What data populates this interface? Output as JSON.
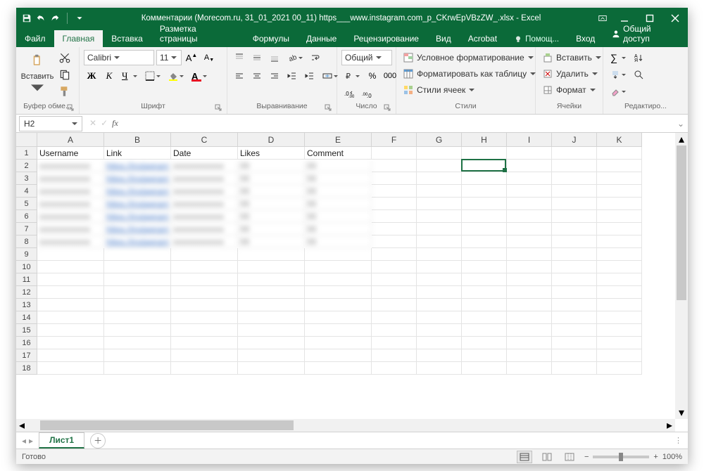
{
  "app": {
    "title": "Комментарии (Morecom.ru, 31_01_2021 00_11) https___www.instagram.com_p_CKrwEpVBzZW_.xlsx - Excel"
  },
  "tabs": {
    "file": "Файл",
    "items": [
      "Главная",
      "Вставка",
      "Разметка страницы",
      "Формулы",
      "Данные",
      "Рецензирование",
      "Вид",
      "Acrobat"
    ],
    "active_index": 0,
    "tell_me": "Помощ...",
    "sign_in": "Вход",
    "share": "Общий доступ"
  },
  "ribbon": {
    "clipboard": {
      "paste": "Вставить",
      "label": "Буфер обме..."
    },
    "font": {
      "name": "Calibri",
      "size": "11",
      "bold": "Ж",
      "italic": "К",
      "underline": "Ч",
      "label": "Шрифт"
    },
    "alignment": {
      "label": "Выравнивание"
    },
    "number": {
      "format": "Общий",
      "label": "Число"
    },
    "styles": {
      "cond": "Условное форматирование",
      "table": "Форматировать как таблицу",
      "cell": "Стили ячеек",
      "label": "Стили"
    },
    "cells": {
      "insert": "Вставить",
      "delete": "Удалить",
      "format": "Формат",
      "label": "Ячейки"
    },
    "editing": {
      "label": "Редактиро..."
    }
  },
  "namebox": {
    "ref": "H2"
  },
  "columns": [
    {
      "letter": "A",
      "width": 95
    },
    {
      "letter": "B",
      "width": 95
    },
    {
      "letter": "C",
      "width": 95
    },
    {
      "letter": "D",
      "width": 95
    },
    {
      "letter": "E",
      "width": 95
    },
    {
      "letter": "F",
      "width": 64
    },
    {
      "letter": "G",
      "width": 64
    },
    {
      "letter": "H",
      "width": 64
    },
    {
      "letter": "I",
      "width": 64
    },
    {
      "letter": "J",
      "width": 64
    },
    {
      "letter": "K",
      "width": 64
    }
  ],
  "headers": [
    "Username",
    "Link",
    "Date",
    "Likes",
    "Comment"
  ],
  "data_rows": 7,
  "total_rows": 18,
  "selected_cell": {
    "col": "H",
    "row": 2
  },
  "sheet": {
    "name": "Лист1"
  },
  "status": {
    "ready": "Готово",
    "zoom": "100%"
  }
}
